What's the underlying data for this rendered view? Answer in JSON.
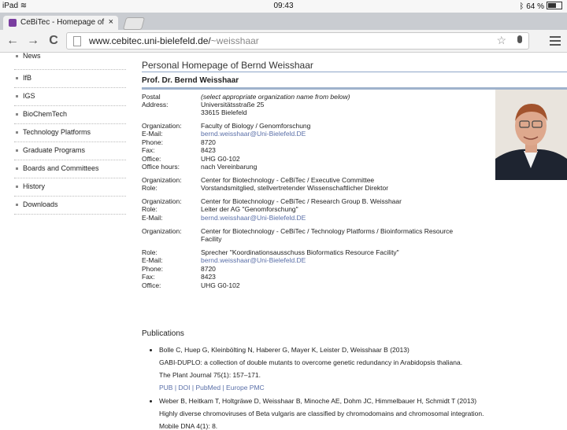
{
  "status_bar": {
    "device": "iPad",
    "wifi_icon": "wifi-icon",
    "time": "09:43",
    "bluetooth_icon": "bluetooth-icon",
    "battery": "64 %"
  },
  "browser": {
    "tab_title": "CeBiTec - Homepage of B",
    "tab_close": "×",
    "url_host": "www.cebitec.uni-bielefeld.de/",
    "url_path": "~weisshaar",
    "back": "←",
    "forward": "→",
    "reload": "C",
    "star": "☆"
  },
  "sidebar": {
    "items": [
      {
        "label": "News"
      },
      {
        "label": "IfB"
      },
      {
        "label": "IGS"
      },
      {
        "label": "BioChemTech"
      },
      {
        "label": "Technology Platforms"
      },
      {
        "label": "Graduate Programs"
      },
      {
        "label": "Boards and Committees"
      },
      {
        "label": "History"
      },
      {
        "label": "Downloads"
      }
    ]
  },
  "page": {
    "title": "Personal Homepage of Bernd Weisshaar",
    "name": "Prof. Dr. Bernd Weisshaar",
    "rows": [
      {
        "label": "Postal",
        "value": "(select appropriate organization name from below)"
      },
      {
        "label": "Address:",
        "value": "Universitätsstraße 25"
      },
      {
        "label": "",
        "value": "33615 Bielefeld"
      },
      {
        "label": "Organization:",
        "value": "Faculty of Biology / Genomforschung"
      },
      {
        "label": "E-Mail:",
        "value": "bernd.weisshaar@Uni-Bielefeld.DE"
      },
      {
        "label": "Phone:",
        "value": "8720"
      },
      {
        "label": "Fax:",
        "value": "8423"
      },
      {
        "label": "Office:",
        "value": "UHG G0-102"
      },
      {
        "label": "Office hours:",
        "value": "nach Vereinbarung"
      },
      {
        "label": "Organization:",
        "value": "Center for Biotechnology - CeBiTec / Executive Committee"
      },
      {
        "label": "Role:",
        "value": "Vorstandsmitglied, stellvertretender Wissenschaftlicher Direktor"
      },
      {
        "label": "Organization:",
        "value": "Center for Biotechnology - CeBiTec / Research Group B. Weisshaar"
      },
      {
        "label": "Role:",
        "value": "Leiter der AG \"Genomforschung\""
      },
      {
        "label": "E-Mail:",
        "value": "bernd.weisshaar@Uni-Bielefeld.DE"
      },
      {
        "label": "Organization:",
        "value": "Center for Biotechnology - CeBiTec / Technology Platforms / Bioinformatics Resource"
      },
      {
        "label": "",
        "value": "Facility"
      },
      {
        "label": "Role:",
        "value": "Sprecher \"Koordinationsausschuss Bioformatics Resource Facility\""
      },
      {
        "label": "E-Mail:",
        "value": "bernd.weisshaar@Uni-Bielefeld.DE"
      },
      {
        "label": "Phone:",
        "value": "8720"
      },
      {
        "label": "Fax:",
        "value": "8423"
      },
      {
        "label": "Office:",
        "value": "UHG G0-102"
      }
    ],
    "publications_title": "Publications",
    "publications": [
      {
        "authors": "Bolle C, Huep G, Kleinbölting N, Haberer G, Mayer K, Leister D, Weisshaar B (2013)",
        "title": "GABI-DUPLO: a collection of double mutants to overcome genetic redundancy in Arabidopsis thaliana.",
        "journal": "The Plant Journal 75(1): 157–171.",
        "links": "PUB | DOI | PubMed | Europe PMC"
      },
      {
        "authors": "Weber B, Heitkam T, Holtgräwe D, Weisshaar B, Minoche AE, Dohm JC, Himmelbauer H, Schmidt T (2013)",
        "title": "Highly diverse chromoviruses of Beta vulgaris are classified by chromodomains and chromosomal integration.",
        "journal": "Mobile DNA 4(1): 8."
      }
    ]
  }
}
